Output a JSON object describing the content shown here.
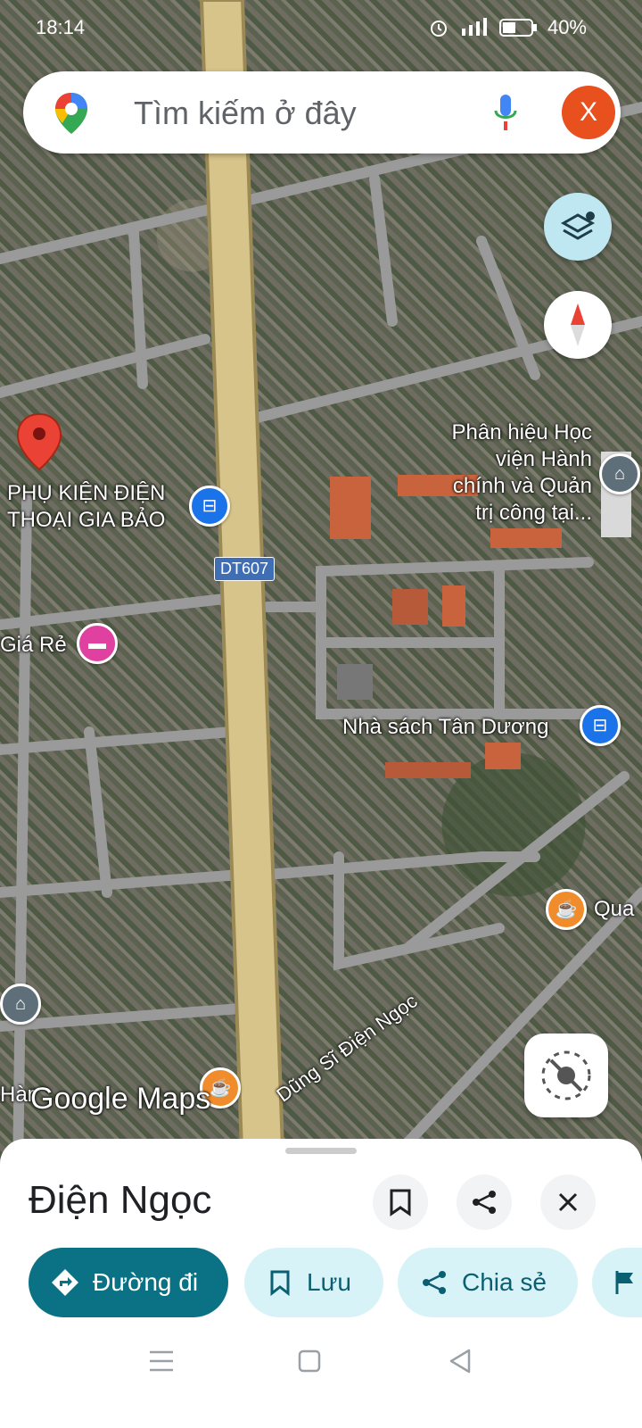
{
  "status_bar": {
    "time": "18:14",
    "battery": "40%"
  },
  "search": {
    "placeholder": "Tìm kiếm ở đây",
    "avatar_letter": "X"
  },
  "map": {
    "road_badge": "DT607",
    "labels": {
      "shop": "PHỤ KIỆN ĐIỆN\nTHOẠI GIA BẢO",
      "school": "Phân hiệu Học\nviện Hành\nchính và Quản\ntrị công tại...",
      "bookstore": "Nhà sách Tân Dương",
      "hotel": "Giá Rẻ",
      "cafe": "Qua",
      "street": "Dũng Sĩ Điện Ngọc",
      "left_edge": "Hàr"
    },
    "watermark": "Google Maps"
  },
  "place_sheet": {
    "title": "Điện Ngọc",
    "actions": {
      "directions": "Đường đi",
      "save": "Lưu",
      "share": "Chia sẻ"
    }
  },
  "colors": {
    "primary": "#0b7285",
    "chip_bg": "#d8f3f7",
    "pin_red": "#ea4335"
  }
}
